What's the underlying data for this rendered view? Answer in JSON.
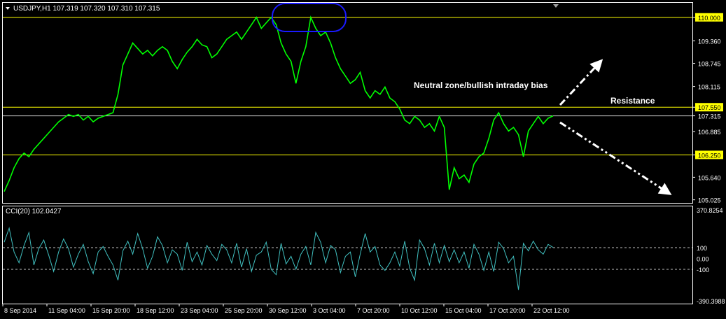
{
  "header": {
    "symbol_line": "USDJPY,H1  107.319 107.320 107.310 107.315",
    "indicator_label": "CCI(20) 102.0427"
  },
  "annotations": {
    "neutral_zone": "Neutral zone/bullish intraday bias",
    "resistance": "Resistance"
  },
  "colors": {
    "background": "#000000",
    "price_line": "#00ff00",
    "cci_line": "#40c0c0",
    "level_line": "#ffff00",
    "grid_frame": "#ffffff",
    "highlight_ellipse": "#1a1aff",
    "arrows": "#ffffff"
  },
  "chart_data": [
    {
      "type": "line",
      "title": "USDJPY,H1",
      "x_tick_labels": [
        "8 Sep 2014",
        "11 Sep 04:00",
        "15 Sep 20:00",
        "18 Sep 12:00",
        "23 Sep 04:00",
        "25 Sep 20:00",
        "30 Sep 12:00",
        "3 Oct 04:00",
        "7 Oct 20:00",
        "10 Oct 12:00",
        "15 Oct 04:00",
        "17 Oct 20:00",
        "22 Oct 12:00"
      ],
      "y_tick_labels": [
        "110.000",
        "109.360",
        "108.745",
        "108.115",
        "107.550",
        "107.315",
        "106.885",
        "106.250",
        "105.640",
        "105.025"
      ],
      "ylim": [
        104.98,
        110.32
      ],
      "horizontal_levels": [
        110.0,
        107.55,
        107.315,
        106.25
      ],
      "series": [
        {
          "values": [
            105.25,
            105.55,
            105.9,
            106.15,
            106.3,
            106.2,
            106.4,
            106.55,
            106.7,
            106.85,
            107.0,
            107.15,
            107.25,
            107.35,
            107.3,
            107.35,
            107.2,
            107.3,
            107.15,
            107.25,
            107.3,
            107.35,
            107.4,
            107.9,
            108.7,
            109.0,
            109.3,
            109.15,
            109.0,
            109.1,
            108.95,
            109.1,
            109.2,
            109.1,
            108.8,
            108.6,
            108.85,
            109.05,
            109.2,
            109.4,
            109.25,
            109.2,
            108.9,
            109.0,
            109.2,
            109.4,
            109.5,
            109.6,
            109.4,
            109.6,
            109.8,
            110.0,
            109.7,
            109.85,
            110.0,
            109.8,
            109.3,
            109.0,
            108.8,
            108.2,
            108.8,
            109.2,
            110.0,
            109.7,
            109.5,
            109.6,
            109.3,
            108.9,
            108.6,
            108.4,
            108.2,
            108.3,
            108.5,
            108.0,
            107.8,
            108.0,
            107.9,
            108.1,
            107.8,
            107.7,
            107.5,
            107.2,
            107.1,
            107.3,
            107.2,
            107.0,
            107.1,
            106.9,
            107.3,
            107.0,
            105.3,
            105.9,
            105.6,
            105.7,
            105.5,
            106.0,
            106.2,
            106.3,
            106.7,
            107.2,
            107.4,
            107.1,
            106.9,
            107.0,
            106.8,
            106.2,
            106.9,
            107.1,
            107.3,
            107.1,
            107.25,
            107.315
          ]
        }
      ]
    },
    {
      "type": "line",
      "title": "CCI(20) 102.0427",
      "y_tick_labels": [
        "370.8254",
        "100",
        "0.00",
        "-100",
        "-390.3988"
      ],
      "ylim": [
        -390.3988,
        370.8254
      ],
      "horizontal_levels": [
        100,
        -100
      ],
      "series": [
        {
          "values": [
            150,
            280,
            60,
            -40,
            120,
            240,
            -60,
            90,
            170,
            30,
            -120,
            60,
            180,
            90,
            -80,
            40,
            130,
            -30,
            -140,
            60,
            110,
            20,
            -60,
            -200,
            70,
            160,
            40,
            230,
            90,
            -90,
            20,
            200,
            120,
            -40,
            80,
            40,
            -110,
            150,
            -30,
            60,
            -60,
            120,
            40,
            -20,
            130,
            80,
            -40,
            140,
            -80,
            90,
            -120,
            30,
            60,
            150,
            -100,
            -150,
            140,
            -50,
            20,
            -100,
            40,
            110,
            -60,
            240,
            150,
            -40,
            120,
            80,
            -130,
            20,
            60,
            -170,
            40,
            230,
            60,
            110,
            -60,
            -110,
            -40,
            60,
            -70,
            160,
            -90,
            -200,
            170,
            90,
            -60,
            140,
            -40,
            120,
            -30,
            80,
            -40,
            60,
            -90,
            130,
            40,
            -110,
            60,
            -120,
            150,
            90,
            -40,
            20,
            -290,
            140,
            70,
            160,
            80,
            40,
            130,
            102
          ]
        }
      ]
    }
  ]
}
